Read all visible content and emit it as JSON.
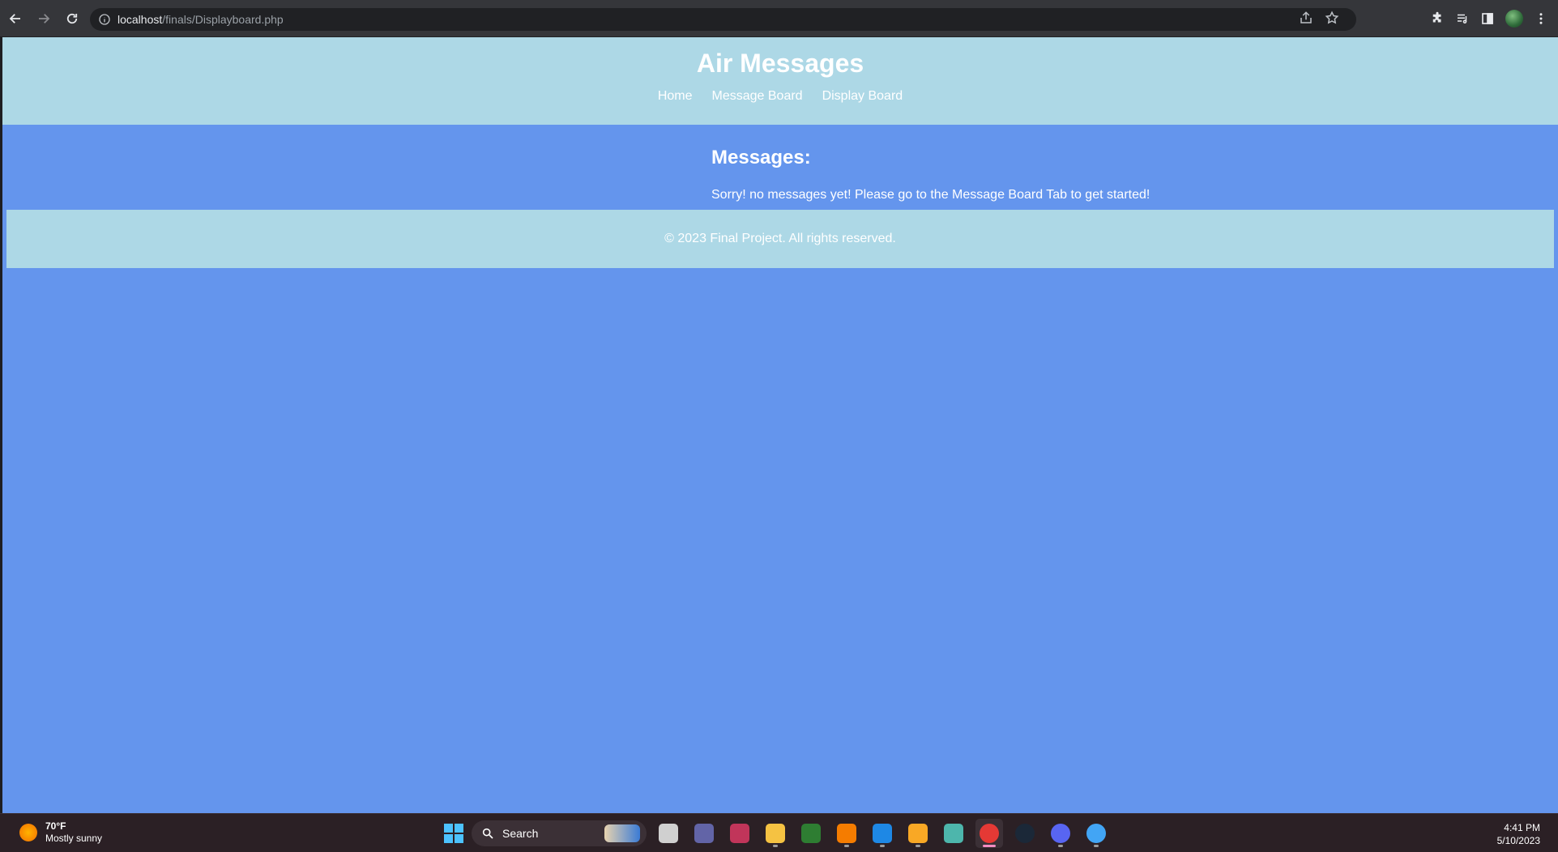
{
  "browser": {
    "url_host": "localhost",
    "url_path": "/finals/Displayboard.php"
  },
  "site": {
    "title": "Air Messages",
    "nav": [
      {
        "label": "Home"
      },
      {
        "label": "Message Board"
      },
      {
        "label": "Display Board"
      }
    ],
    "messages_heading": "Messages:",
    "empty_message": "Sorry! no messages yet! Please go to the Message Board Tab to get started!",
    "footer": "© 2023 Final Project. All rights reserved."
  },
  "taskbar": {
    "weather_temp": "70°F",
    "weather_condition": "Mostly sunny",
    "search_label": "Search",
    "time": "4:41 PM",
    "date": "5/10/2023",
    "apps": [
      {
        "icon": "task-view-icon",
        "color": "#d0d0d0"
      },
      {
        "icon": "teams-chat-icon",
        "color": "#6264a7"
      },
      {
        "icon": "access-icon",
        "color": "#c1355a"
      },
      {
        "icon": "file-explorer-icon",
        "color": "#f5c242"
      },
      {
        "icon": "cursor-app-icon",
        "color": "#2e7d32"
      },
      {
        "icon": "xampp-icon",
        "color": "#f57c00"
      },
      {
        "icon": "intellij-icon",
        "color": "#1e88e5"
      },
      {
        "icon": "figma-like-icon",
        "color": "#f9a825"
      },
      {
        "icon": "android-app-icon",
        "color": "#4db6ac"
      },
      {
        "icon": "chrome-icon",
        "color": "#e53935"
      },
      {
        "icon": "steam-icon",
        "color": "#1b2838"
      },
      {
        "icon": "discord-icon",
        "color": "#5865f2"
      },
      {
        "icon": "globe-app-icon",
        "color": "#42a5f5"
      }
    ]
  },
  "colors": {
    "page_bg": "#6495ed",
    "header_bg": "#add8e6",
    "footer_bg": "#add8e6"
  }
}
